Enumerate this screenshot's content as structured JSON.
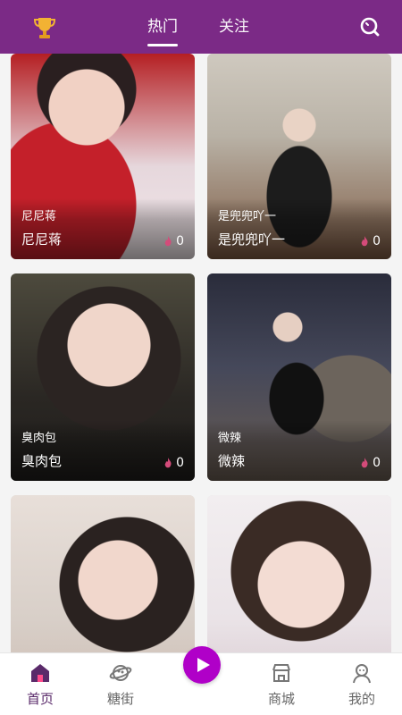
{
  "header": {
    "tabs": [
      {
        "label": "热门",
        "active": true
      },
      {
        "label": "关注",
        "active": false
      }
    ],
    "icons": {
      "left": "trophy-icon",
      "right": "search-icon"
    },
    "colors": {
      "bar": "#7b2a86"
    }
  },
  "feed": {
    "cards": [
      {
        "title": "尼尼蒋",
        "name": "尼尼蒋",
        "likes": "0"
      },
      {
        "title": "是兜兜吖一",
        "name": "是兜兜吖一",
        "likes": "0"
      },
      {
        "title": "臭肉包",
        "name": "臭肉包",
        "likes": "0"
      },
      {
        "title": "微辣",
        "name": "微辣",
        "likes": "0"
      },
      {
        "title": "",
        "name": "",
        "likes": ""
      },
      {
        "title": "",
        "name": "",
        "likes": ""
      }
    ],
    "like_icon": "flame-icon"
  },
  "bottom_nav": {
    "items": [
      {
        "label": "首页",
        "icon": "home-icon",
        "active": true
      },
      {
        "label": "糖街",
        "icon": "planet-icon",
        "active": false
      },
      {
        "label": "",
        "icon": "play-icon",
        "active": false
      },
      {
        "label": "商城",
        "icon": "shop-icon",
        "active": false
      },
      {
        "label": "我的",
        "icon": "profile-icon",
        "active": false
      }
    ],
    "colors": {
      "play": "#b000c8",
      "active": "#5a2a6a"
    }
  }
}
